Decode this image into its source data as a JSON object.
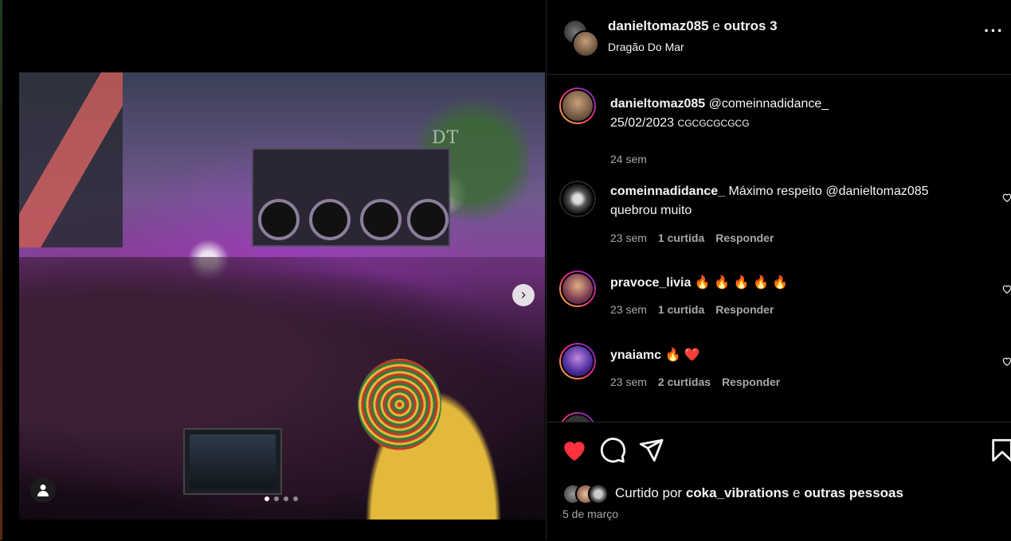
{
  "post": {
    "header": {
      "username": "danieltomaz085",
      "and_text": "e",
      "others": "outros 3",
      "location": "Dragão Do Mar"
    },
    "media": {
      "watermark": "DT",
      "carousel_total": 4,
      "carousel_active": 1
    },
    "caption": {
      "username": "danieltomaz085",
      "text_line1": "@comeinnadidance_",
      "text_line2_date": "25/02/2023",
      "text_line2_extra": "cgcgcgcgcg",
      "time": "24 sem"
    },
    "comments": [
      {
        "username": "comeinnadidance_",
        "text": "Máximo respeito @danieltomaz085 quebrou muito",
        "time": "23 sem",
        "likes": "1 curtida",
        "reply": "Responder"
      },
      {
        "username": "pravoce_livia",
        "text": "🔥 🔥 🔥 🔥 🔥",
        "time": "23 sem",
        "likes": "1 curtida",
        "reply": "Responder"
      },
      {
        "username": "ynaiamc",
        "text": "🔥 ❤️",
        "time": "23 sem",
        "likes": "2 curtidas",
        "reply": "Responder"
      }
    ],
    "likes": {
      "prefix": "Curtido por",
      "user": "coka_vibrations",
      "and_text": "e",
      "others": "outras pessoas"
    },
    "date": "5 de março"
  },
  "colors": {
    "background": "#000000",
    "like_red": "#ff3040",
    "secondary_text": "#a8a8a8",
    "divider": "#262626"
  }
}
